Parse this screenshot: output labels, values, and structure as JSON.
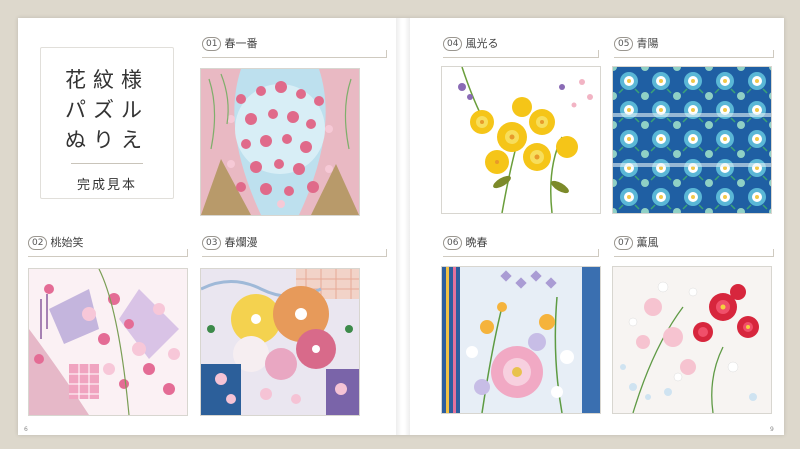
{
  "book": {
    "title_lines": [
      "花紋様",
      "パズル",
      "ぬりえ"
    ],
    "subtitle": "完成見本"
  },
  "samples": [
    {
      "num": "01",
      "name": "春一番",
      "palette": "sky-pink"
    },
    {
      "num": "02",
      "name": "桃始笑",
      "palette": "pink-lavender"
    },
    {
      "num": "03",
      "name": "春爛漫",
      "palette": "multicolor"
    },
    {
      "num": "04",
      "name": "風光る",
      "palette": "yellow-green"
    },
    {
      "num": "05",
      "name": "青陽",
      "palette": "blue-teal"
    },
    {
      "num": "06",
      "name": "晩春",
      "palette": "pink-blue"
    },
    {
      "num": "07",
      "name": "薫風",
      "palette": "red-white"
    }
  ],
  "folio": {
    "left": "6",
    "right": "9"
  },
  "colors": {
    "background": "#ddd8cc",
    "page": "#ffffff",
    "rule": "#cfcac0"
  }
}
